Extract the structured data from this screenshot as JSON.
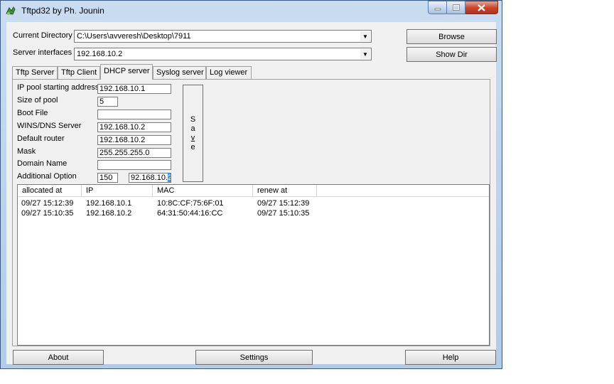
{
  "window": {
    "title": "Tftpd32 by Ph. Jounin"
  },
  "top": {
    "current_directory_label": "Current Directory",
    "current_directory_value": "C:\\Users\\avveresh\\Desktop\\7911",
    "server_interfaces_label": "Server interfaces",
    "server_interfaces_value": "192.168.10.2",
    "browse_label": "Browse",
    "show_dir_label": "Show Dir"
  },
  "tabs": [
    {
      "label": "Tftp Server"
    },
    {
      "label": "Tftp Client"
    },
    {
      "label": "DHCP server"
    },
    {
      "label": "Syslog server"
    },
    {
      "label": "Log viewer"
    }
  ],
  "dhcp": {
    "ip_pool_label": "IP pool starting address",
    "ip_pool_value": "192.168.10.1",
    "pool_size_label": "Size of pool",
    "pool_size_value": "5",
    "boot_file_label": "Boot File",
    "boot_file_value": "",
    "wins_dns_label": "WINS/DNS Server",
    "wins_dns_value": "192.168.10.2",
    "default_router_label": "Default router",
    "default_router_value": "192.168.10.2",
    "mask_label": "Mask",
    "mask_value": "255.255.255.0",
    "domain_name_label": "Domain Name",
    "domain_name_value": "",
    "additional_option_label": "Additional Option",
    "additional_option_code": "150",
    "additional_option_value_before": "92.168.10.",
    "additional_option_value_selected": "2",
    "save_letters": [
      "S",
      "a",
      "v",
      "e"
    ]
  },
  "table": {
    "columns": [
      "allocated at",
      "IP",
      "MAC",
      "renew at"
    ],
    "rows": [
      [
        "09/27 15:12:39",
        "192.168.10.1",
        "10:8C:CF:75:6F:01",
        "09/27 15:12:39"
      ],
      [
        "09/27 15:10:35",
        "192.168.10.2",
        "64:31:50:44:16:CC",
        "09/27 15:10:35"
      ]
    ]
  },
  "bottom": {
    "about_label": "About",
    "settings_label": "Settings",
    "help_label": "Help"
  }
}
